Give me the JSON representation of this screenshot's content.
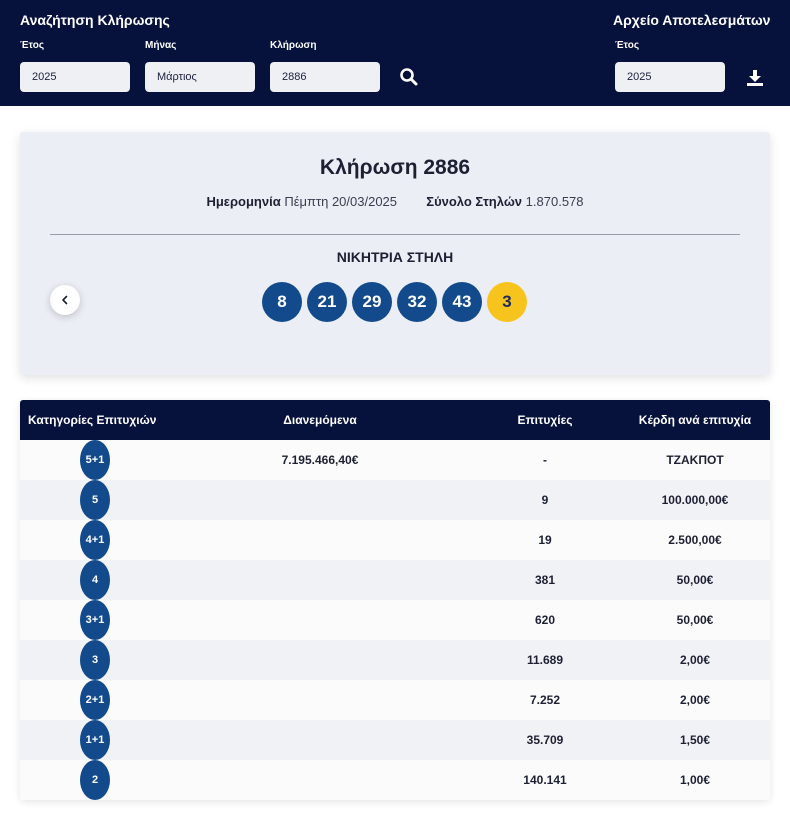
{
  "search": {
    "title": "Αναζήτηση Κλήρωσης",
    "year_label": "Έτος",
    "year_value": "2025",
    "month_label": "Μήνας",
    "month_value": "Μάρτιος",
    "draw_label": "Κλήρωση",
    "draw_value": "2886"
  },
  "archive": {
    "title": "Αρχείο Αποτελεσμάτων",
    "year_label": "Έτος",
    "year_value": "2025"
  },
  "draw": {
    "title": "Κλήρωση 2886",
    "date_label": "Ημερομηνία",
    "date_value": "Πέμπτη 20/03/2025",
    "columns_label": "Σύνολο Στηλών",
    "columns_value": "1.870.578",
    "winning_label": "ΝΙΚΗΤΡΙΑ ΣΤΗΛΗ",
    "numbers": [
      "8",
      "21",
      "29",
      "32",
      "43"
    ],
    "joker": "3"
  },
  "table": {
    "headers": [
      "Κατηγορίες Επιτυχιών",
      "Διανεμόμενα",
      "Επιτυχίες",
      "Κέρδη ανά επιτυχία"
    ],
    "rows": [
      {
        "category": "5+1",
        "distributed": "7.195.466,40€",
        "winners": "-",
        "prize": "ΤΖΑΚΠΟΤ"
      },
      {
        "category": "5",
        "distributed": "",
        "winners": "9",
        "prize": "100.000,00€"
      },
      {
        "category": "4+1",
        "distributed": "",
        "winners": "19",
        "prize": "2.500,00€"
      },
      {
        "category": "4",
        "distributed": "",
        "winners": "381",
        "prize": "50,00€"
      },
      {
        "category": "3+1",
        "distributed": "",
        "winners": "620",
        "prize": "50,00€"
      },
      {
        "category": "3",
        "distributed": "",
        "winners": "11.689",
        "prize": "2,00€"
      },
      {
        "category": "2+1",
        "distributed": "",
        "winners": "7.252",
        "prize": "2,00€"
      },
      {
        "category": "1+1",
        "distributed": "",
        "winners": "35.709",
        "prize": "1,50€"
      },
      {
        "category": "2",
        "distributed": "",
        "winners": "140.141",
        "prize": "1,00€"
      }
    ]
  },
  "icons": {
    "search": "search-icon",
    "download": "download-icon",
    "prev": "chevron-left-icon"
  },
  "colors": {
    "header_bg": "#06113c",
    "ball_blue": "#124a8c",
    "ball_joker": "#f7c41d"
  }
}
